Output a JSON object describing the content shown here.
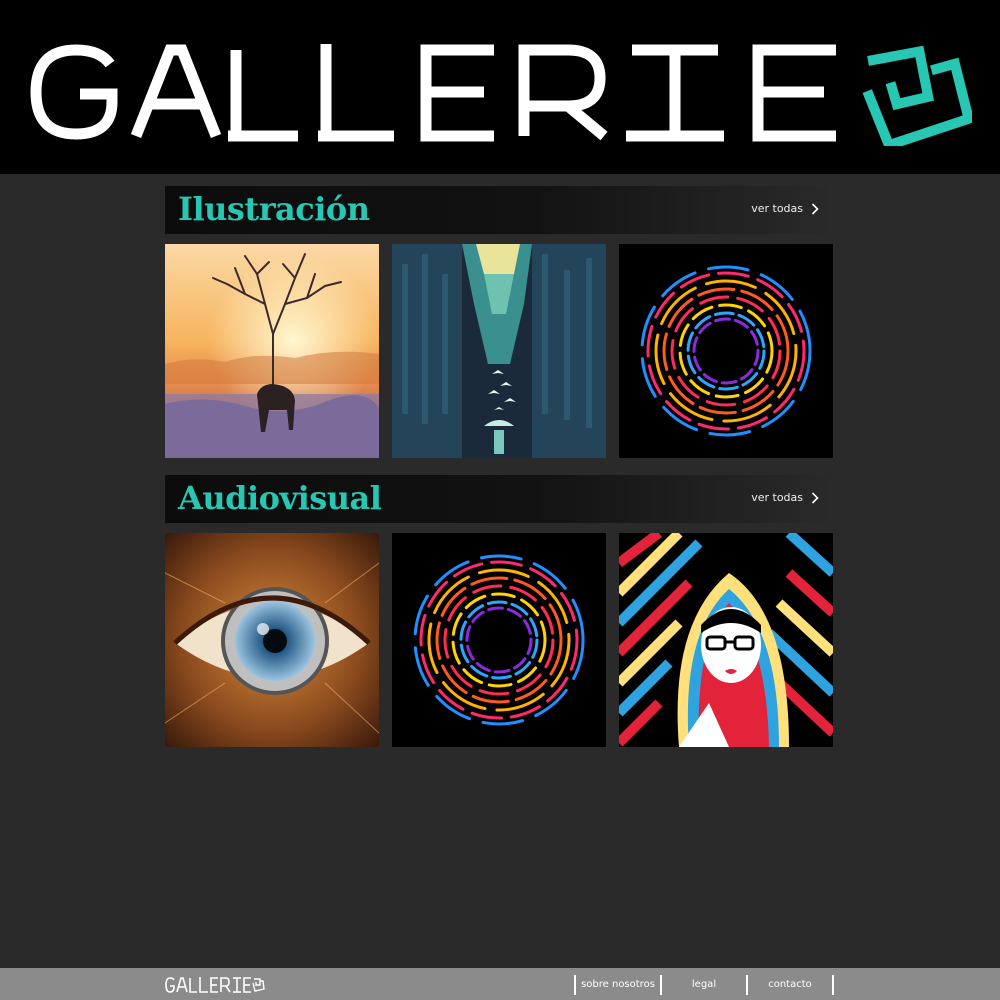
{
  "brand": {
    "name": "GALLERIE",
    "accent_color": "#27c7b4",
    "logo_icon": "square-bracket-logo-icon"
  },
  "sections": [
    {
      "title": "Ilustración",
      "see_all_label": "ver todas",
      "see_all_icon": "chevron-right-icon",
      "items": [
        {
          "artwork": "deer-with-tree-antlers-at-sunrise"
        },
        {
          "artwork": "figure-with-umbrella-between-skyscrapers-birds-flying-up"
        },
        {
          "artwork": "rainbow-paint-vortex-on-black"
        }
      ]
    },
    {
      "title": "Audiovisual",
      "see_all_label": "ver todas",
      "see_all_icon": "chevron-right-icon",
      "items": [
        {
          "artwork": "eye-with-camera-lens-iris"
        },
        {
          "artwork": "rainbow-paint-vortex-on-black"
        },
        {
          "artwork": "woman-with-glasses-in-colorful-patterned-hood"
        }
      ]
    }
  ],
  "footer": {
    "brand": "GALLERIE",
    "links": [
      "sobre nosotros",
      "legal",
      "contacto"
    ],
    "background": "#8b8b8b"
  },
  "colors": {
    "page_background": "#2a2a2a",
    "header_background": "#000000",
    "title_color": "#27c7b4"
  }
}
